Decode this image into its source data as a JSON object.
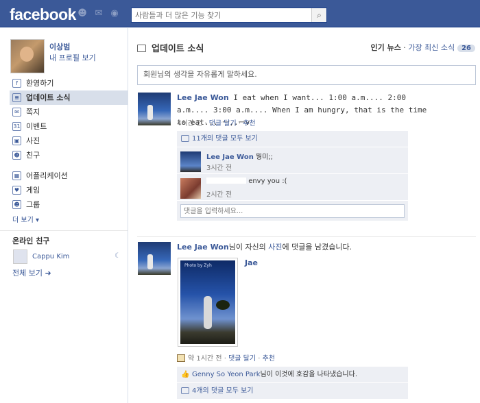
{
  "topbar": {
    "logo": "facebook",
    "jewels": [
      "friends-icon",
      "messages-icon",
      "notifications-icon"
    ],
    "search": {
      "placeholder": "사람들과 더 많은 기능 찾기",
      "value": ""
    }
  },
  "profile": {
    "name": "이상범",
    "edit_link": "내 프로필 보기"
  },
  "nav": {
    "items": [
      {
        "label": "환영하기",
        "icon": "welcome-icon",
        "glyph": "f"
      },
      {
        "label": "업데이트 소식",
        "icon": "news-feed-icon",
        "glyph": "≡"
      },
      {
        "label": "쪽지",
        "icon": "messages-icon",
        "glyph": "✉"
      },
      {
        "label": "이벤트",
        "icon": "events-icon",
        "glyph": "31"
      },
      {
        "label": "사진",
        "icon": "photos-icon",
        "glyph": "▣"
      },
      {
        "label": "친구",
        "icon": "friends-icon",
        "glyph": "☻"
      }
    ],
    "apps": [
      {
        "label": "어플리케이션",
        "icon": "applications-icon",
        "glyph": "▦"
      },
      {
        "label": "게임",
        "icon": "games-icon",
        "glyph": "♥"
      },
      {
        "label": "그룹",
        "icon": "groups-icon",
        "glyph": "☻"
      }
    ],
    "more": "더 보기 ▾"
  },
  "online": {
    "title": "온라인 친구",
    "friends": [
      {
        "name": "Cappu Kim",
        "status_icon": "idle-moon-icon"
      }
    ],
    "see_all": "전체 보기 ➜"
  },
  "main": {
    "title": "업데이트 소식",
    "sort": {
      "top": "인기 뉴스",
      "sep": " · ",
      "recent": "가장 최신 소식",
      "count": "26"
    },
    "composer_placeholder": "회원님의 생각을 자유롭게 말하세요."
  },
  "stories": [
    {
      "actor": "Lee Jae Won",
      "text": " I eat when I want... 1:00 a.m.... 2:00 a.m.... 3:00 a.m.... When I am hungry, that is the time to eat... ㅡ,.ㅡv",
      "time": "4시간 전",
      "actions": {
        "sep1": " · ",
        "comment": "댓글 달기",
        "sep2": " · ",
        "like": "추천"
      },
      "view_all": "11개의 댓글 모두 보기",
      "comments": [
        {
          "actor": "Lee Jae Won",
          "text": " 뭥미;;",
          "time": "3시간 전"
        },
        {
          "actor": "",
          "text": "envy you :(",
          "time": "2시간 전"
        }
      ],
      "comment_placeholder": "댓글을 입력하세요..."
    },
    {
      "actor": "Lee Jae Won",
      "text": "님이 자신의 ",
      "text_link": "사진",
      "text_tail": "에 댓글을 남겼습니다.",
      "photo_title": "Jae",
      "photo_caption": "Photo by Zyh",
      "time": "약 1시간 전",
      "actions": {
        "sep1": " · ",
        "comment": "댓글 달기",
        "sep2": " · ",
        "like": "추천"
      },
      "likes": {
        "actor": "Genny So Yeon Park",
        "text": "님이 이것에 호감을 나타냈습니다."
      },
      "view_all": "4개의 댓글 모두 보기"
    }
  ]
}
